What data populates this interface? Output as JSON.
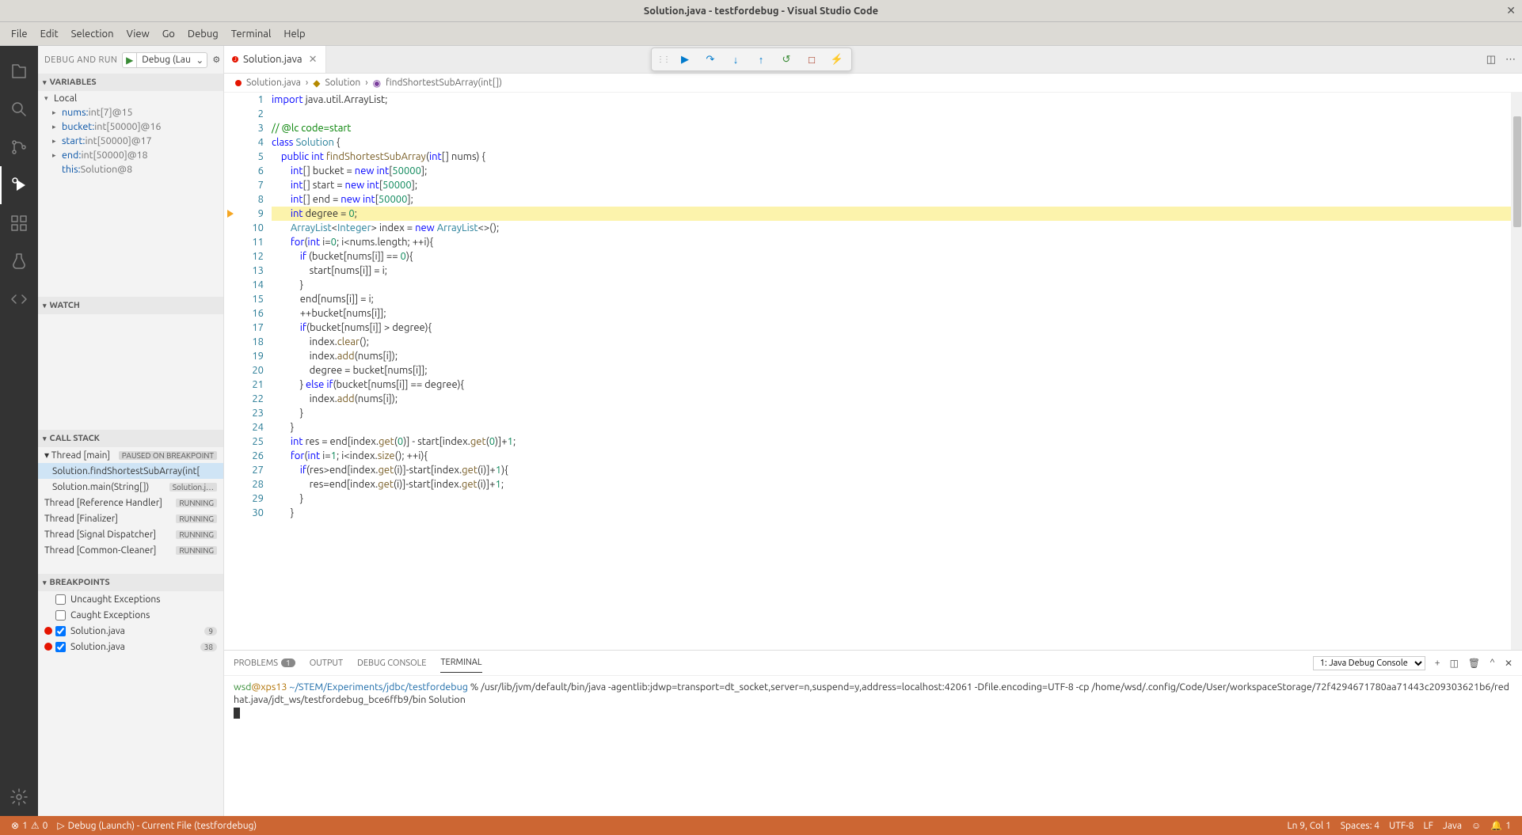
{
  "titlebar": {
    "title": "Solution.java - testfordebug - Visual Studio Code"
  },
  "menu": [
    "File",
    "Edit",
    "Selection",
    "View",
    "Go",
    "Debug",
    "Terminal",
    "Help"
  ],
  "sidebar": {
    "header": "DEBUG AND RUN",
    "config": "Debug (Lau",
    "sections": {
      "variables": "VARIABLES",
      "local": "Local",
      "vars": [
        {
          "name": "nums:",
          "val": " int[7]@15",
          "exp": true
        },
        {
          "name": "bucket:",
          "val": " int[50000]@16",
          "exp": true
        },
        {
          "name": "start:",
          "val": " int[50000]@17",
          "exp": true
        },
        {
          "name": "end:",
          "val": " int[50000]@18",
          "exp": true
        },
        {
          "name": "this:",
          "val": " Solution@8",
          "exp": false
        }
      ],
      "watch": "WATCH",
      "callstack": "CALL STACK",
      "threads": [
        {
          "name": "Thread [main]",
          "status": "PAUSED ON BREAKPOINT",
          "exp": true,
          "st_cls": "paused"
        },
        {
          "name": "Solution.findShortestSubArray(int[",
          "status": "",
          "sel": true,
          "indent": true
        },
        {
          "name": "Solution.main(String[])",
          "status": "Solution.j…",
          "indent": true
        },
        {
          "name": "Thread [Reference Handler]",
          "status": "RUNNING"
        },
        {
          "name": "Thread [Finalizer]",
          "status": "RUNNING"
        },
        {
          "name": "Thread [Signal Dispatcher]",
          "status": "RUNNING"
        },
        {
          "name": "Thread [Common-Cleaner]",
          "status": "RUNNING"
        }
      ],
      "breakpoints": "BREAKPOINTS",
      "bps": [
        {
          "label": "Uncaught Exceptions",
          "checked": false,
          "dot": false
        },
        {
          "label": "Caught Exceptions",
          "checked": false,
          "dot": false
        },
        {
          "label": "Solution.java",
          "checked": true,
          "dot": true,
          "badge": "9"
        },
        {
          "label": "Solution.java",
          "checked": true,
          "dot": true,
          "badge": "38"
        }
      ]
    }
  },
  "tab": {
    "name": "Solution.java"
  },
  "breadcrumb": {
    "file": "Solution.java",
    "cls": "Solution",
    "method": "findShortestSubArray(int[])"
  },
  "panel": {
    "tabs": {
      "problems": "PROBLEMS",
      "pc": "1",
      "output": "OUTPUT",
      "debug": "DEBUG CONSOLE",
      "terminal": "TERMINAL"
    },
    "select": "1: Java Debug Console",
    "term_user": "wsd",
    "term_host": "@xps13 ",
    "term_path": "~/STEM/Experiments/jdbc/testfordebug",
    "term_prompt": " % ",
    "term_cmd": "/usr/lib/jvm/default/bin/java -agentlib:jdwp=transport=dt_socket,server=n,suspend=y,address=localhost:42061 -Dfile.encoding=UTF-8 -cp /home/wsd/.config/Code/User/workspaceStorage/72f4294671780aa71443c209303621b6/redhat.java/jdt_ws/testfordebug_bce6ffb9/bin Solution"
  },
  "status": {
    "errors": "1",
    "warnings": "0",
    "debug": "Debug (Launch) - Current File (testfordebug)",
    "lncol": "Ln 9, Col 1",
    "spaces": "Spaces: 4",
    "enc": "UTF-8",
    "eol": "LF",
    "lang": "Java",
    "bell": "1"
  }
}
